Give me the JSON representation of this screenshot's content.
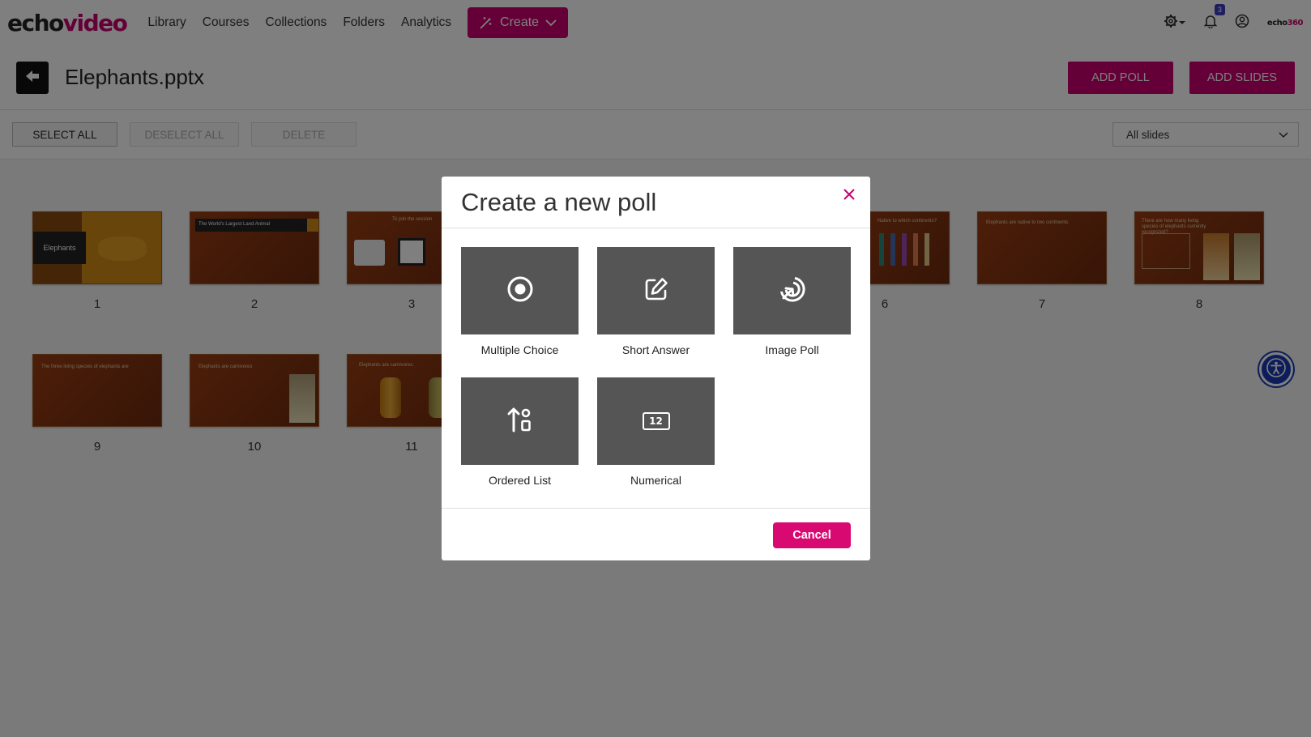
{
  "nav": {
    "logo_echo": "echo",
    "logo_video": "video",
    "links": [
      "Library",
      "Courses",
      "Collections",
      "Folders",
      "Analytics"
    ],
    "create_label": "Create",
    "notification_count": "3",
    "brand_echo": "echo",
    "brand_num": "360"
  },
  "header": {
    "title": "Elephants.pptx",
    "add_poll": "ADD POLL",
    "add_slides": "ADD SLIDES"
  },
  "toolbar": {
    "select_all": "SELECT ALL",
    "deselect_all": "DESELECT ALL",
    "delete": "DELETE",
    "filter_value": "All slides"
  },
  "slides": [
    {
      "number": "1",
      "text": "Elephants"
    },
    {
      "number": "2",
      "text": "The World's Largest Land Animal"
    },
    {
      "number": "3",
      "text": "To join the session"
    },
    {
      "number": "6",
      "text": "Native to which continents?"
    },
    {
      "number": "7",
      "text": "Elephants are native to two continents"
    },
    {
      "number": "8",
      "text": "There are how many living species of elephants currently recognized?"
    },
    {
      "number": "9",
      "text": "The three living species of elephants are"
    },
    {
      "number": "10",
      "text": "Elephants are carnivores"
    },
    {
      "number": "11",
      "text": "Elephants are carnivores."
    }
  ],
  "modal": {
    "title": "Create a new poll",
    "options": [
      {
        "label": "Multiple Choice",
        "icon": "radio-icon"
      },
      {
        "label": "Short Answer",
        "icon": "edit-icon"
      },
      {
        "label": "Image Poll",
        "icon": "target-icon"
      },
      {
        "label": "Ordered List",
        "icon": "ordered-list-icon"
      },
      {
        "label": "Numerical",
        "icon": "number-icon"
      }
    ],
    "cancel": "Cancel",
    "numerical_glyph": "12"
  },
  "colors": {
    "brand": "#c8006e",
    "overlay": "rgba(0,0,0,0.5)",
    "tile": "#555555",
    "accessibility": "#1b3bb5"
  }
}
